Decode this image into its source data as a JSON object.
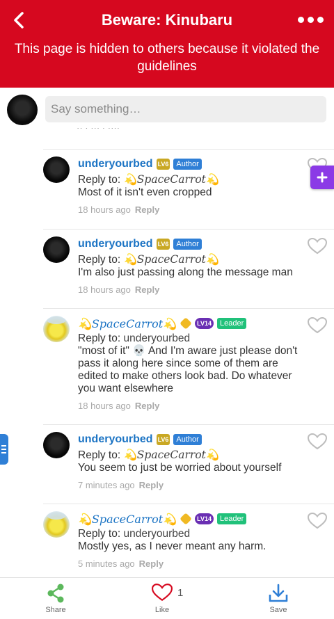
{
  "header": {
    "title": "Beware: Kinubaru",
    "notice": "This page is hidden to others because it violated the guidelines",
    "back_icon": "chevron-left-icon",
    "more_icon": "more-dots-icon",
    "color": "#d6081f"
  },
  "compose": {
    "placeholder": "Say something…",
    "cut_text": "·· · ··· · ····"
  },
  "comments": [
    {
      "username": "underyourbed",
      "level": "LV6",
      "role": "Author",
      "reply_label": "Reply to: ",
      "reply_target": "💫SpaceCarrot💫",
      "body": "Most of it isn't even cropped",
      "time": "18 hours ago",
      "reply": "Reply"
    },
    {
      "username": "underyourbed",
      "level": "LV6",
      "role": "Author",
      "reply_label": "Reply to: ",
      "reply_target": "💫SpaceCarrot💫",
      "body": "I'm also just passing along the message man",
      "time": "18 hours ago",
      "reply": "Reply"
    },
    {
      "username": "💫SpaceCarrot💫",
      "level": "LV14",
      "role": "Leader",
      "reply_label": "Reply to: ",
      "reply_target": "underyourbed",
      "body": "\"most of it\" 💀 And I'm aware just please don't pass it along here since some of them are edited to make others look bad. Do whatever you want elsewhere",
      "time": "18 hours ago",
      "reply": "Reply"
    },
    {
      "username": "underyourbed",
      "level": "LV6",
      "role": "Author",
      "reply_label": "Reply to: ",
      "reply_target": "💫SpaceCarrot💫",
      "body": "You seem to just be worried about yourself",
      "time": "7 minutes ago",
      "reply": "Reply"
    },
    {
      "username": "💫SpaceCarrot💫",
      "level": "LV14",
      "role": "Leader",
      "reply_label": "Reply to: ",
      "reply_target": "underyourbed",
      "body": "Mostly yes, as I never meant any harm.",
      "time": "5 minutes ago",
      "reply": "Reply"
    }
  ],
  "bottom_bar": {
    "share": "Share",
    "like": "Like",
    "like_count": "1",
    "save": "Save",
    "share_color": "#5cb85c",
    "like_color": "#d6081f",
    "save_color": "#2f7fd6"
  }
}
